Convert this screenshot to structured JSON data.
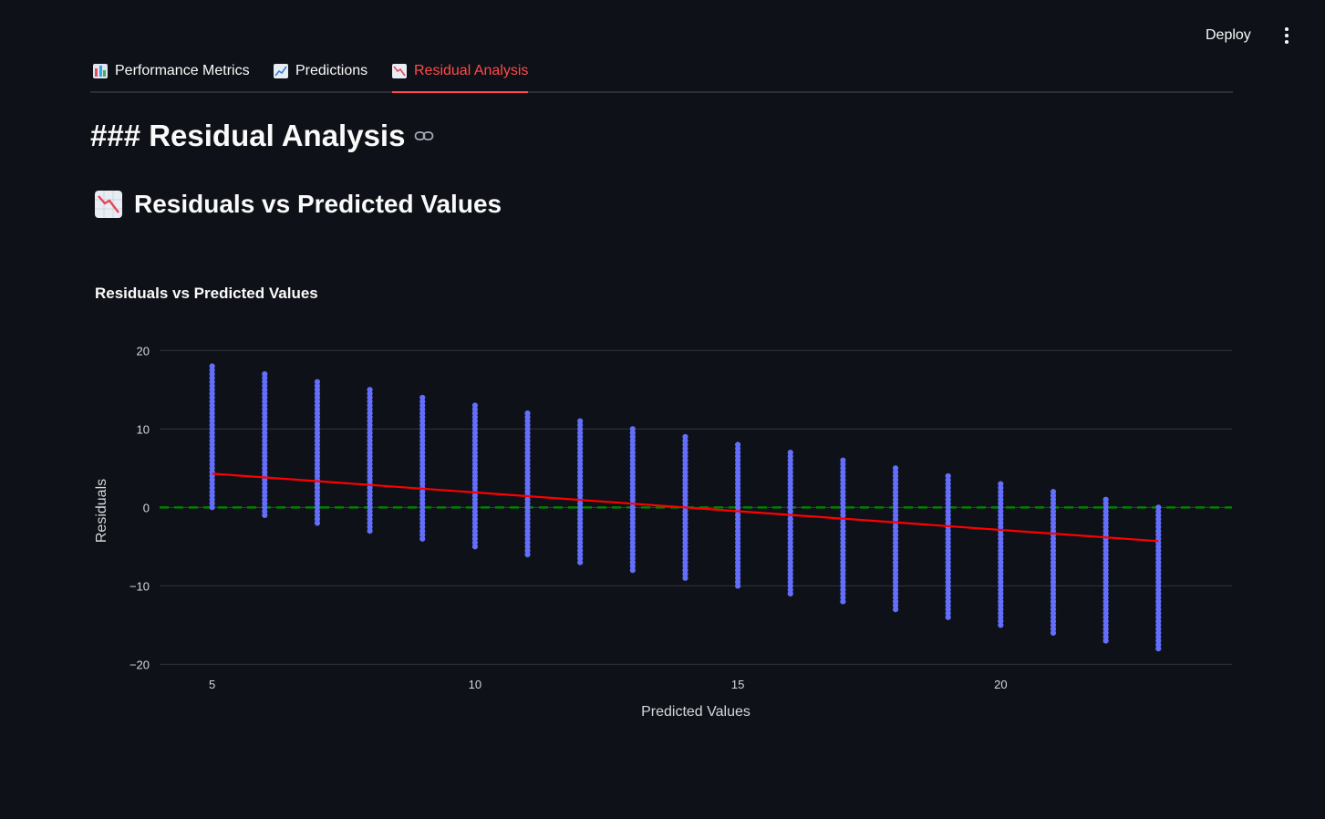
{
  "header": {
    "deploy_label": "Deploy",
    "menu_icon": "kebab-menu-icon"
  },
  "tabs": [
    {
      "label": "Performance Metrics",
      "icon": "bar-chart-icon",
      "active": false
    },
    {
      "label": "Predictions",
      "icon": "line-chart-icon",
      "active": false
    },
    {
      "label": "Residual Analysis",
      "icon": "chart-decreasing-icon",
      "active": true
    }
  ],
  "main": {
    "heading": "### Residual Analysis",
    "subheading": "Residuals vs Predicted Values",
    "subheading_icon": "chart-decreasing-icon"
  },
  "colors": {
    "background": "#0e1117",
    "accent": "#ff4b4b",
    "points": "#636efa",
    "trend": "#ff0000",
    "zero_line": "#008000"
  },
  "chart_data": {
    "type": "scatter",
    "title": "Residuals vs Predicted Values",
    "xlabel": "Predicted Values",
    "ylabel": "Residuals",
    "xlim": [
      4,
      24.4
    ],
    "ylim": [
      -21,
      20.5
    ],
    "xticks": [
      5,
      10,
      15,
      20
    ],
    "yticks": [
      -20,
      -10,
      0,
      10,
      20
    ],
    "grid": true,
    "legend": "none",
    "columns": [
      {
        "x": 5,
        "ymin": 0,
        "ymax": 18
      },
      {
        "x": 6,
        "ymin": -1,
        "ymax": 17
      },
      {
        "x": 7,
        "ymin": -2,
        "ymax": 16
      },
      {
        "x": 8,
        "ymin": -3,
        "ymax": 15
      },
      {
        "x": 9,
        "ymin": -4,
        "ymax": 14
      },
      {
        "x": 10,
        "ymin": -5,
        "ymax": 13
      },
      {
        "x": 11,
        "ymin": -6,
        "ymax": 12
      },
      {
        "x": 12,
        "ymin": -7,
        "ymax": 11
      },
      {
        "x": 13,
        "ymin": -8,
        "ymax": 10
      },
      {
        "x": 14,
        "ymin": -9,
        "ymax": 9
      },
      {
        "x": 15,
        "ymin": -10,
        "ymax": 8
      },
      {
        "x": 16,
        "ymin": -11,
        "ymax": 7
      },
      {
        "x": 17,
        "ymin": -12,
        "ymax": 6
      },
      {
        "x": 18,
        "ymin": -13,
        "ymax": 5
      },
      {
        "x": 19,
        "ymin": -14,
        "ymax": 4
      },
      {
        "x": 20,
        "ymin": -15,
        "ymax": 3
      },
      {
        "x": 21,
        "ymin": -16,
        "ymax": 2
      },
      {
        "x": 22,
        "ymin": -17,
        "ymax": 1
      },
      {
        "x": 23,
        "ymin": -18,
        "ymax": 0
      }
    ],
    "trend_line": {
      "x": [
        5,
        23
      ],
      "y": [
        4.3,
        -4.3
      ]
    },
    "zero_line": {
      "y": 0,
      "style": "dashed"
    }
  }
}
